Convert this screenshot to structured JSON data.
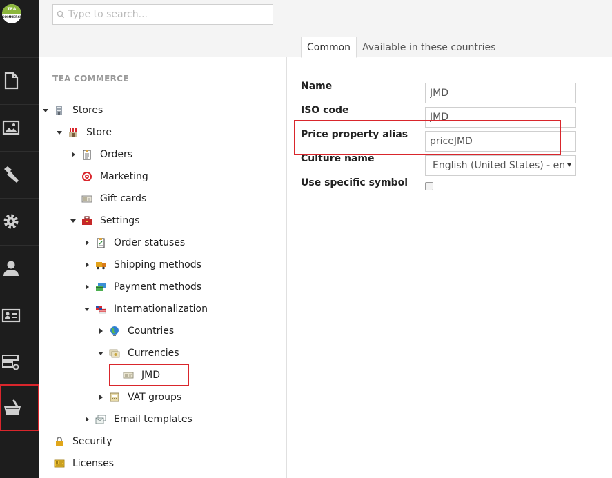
{
  "app": {
    "logo_line1": "TEA",
    "logo_line2": "COMMERCE",
    "sections": [
      {
        "icon": "document-icon"
      },
      {
        "icon": "image-icon"
      },
      {
        "icon": "wrench-icon"
      },
      {
        "icon": "gear-icon"
      },
      {
        "icon": "user-icon"
      },
      {
        "icon": "id-card-icon"
      },
      {
        "icon": "layout-add-icon"
      },
      {
        "icon": "basket-icon",
        "active": true
      }
    ]
  },
  "search": {
    "placeholder": "Type to search..."
  },
  "tree": {
    "section_title": "TEA COMMERCE",
    "nodes": {
      "stores": "Stores",
      "store": "Store",
      "orders": "Orders",
      "marketing": "Marketing",
      "gift_cards": "Gift cards",
      "settings": "Settings",
      "order_statuses": "Order statuses",
      "shipping_methods": "Shipping methods",
      "payment_methods": "Payment methods",
      "internationalization": "Internationalization",
      "countries": "Countries",
      "currencies": "Currencies",
      "jmd": "JMD",
      "vat_groups": "VAT groups",
      "email_templates": "Email templates",
      "security": "Security",
      "licenses": "Licenses"
    }
  },
  "tabs": {
    "common": "Common",
    "countries": "Available in these countries"
  },
  "form": {
    "name_label": "Name",
    "name_value": "JMD",
    "iso_label": "ISO code",
    "iso_value": "JMD",
    "alias_label": "Price property alias",
    "alias_value": "priceJMD",
    "culture_label": "Culture name",
    "culture_value": "English (United States) - en-US",
    "symbol_label": "Use specific symbol"
  },
  "colors": {
    "sidebar": "#1d1d1d",
    "highlight": "#d9262c",
    "header_bg": "#f4f4f4"
  }
}
